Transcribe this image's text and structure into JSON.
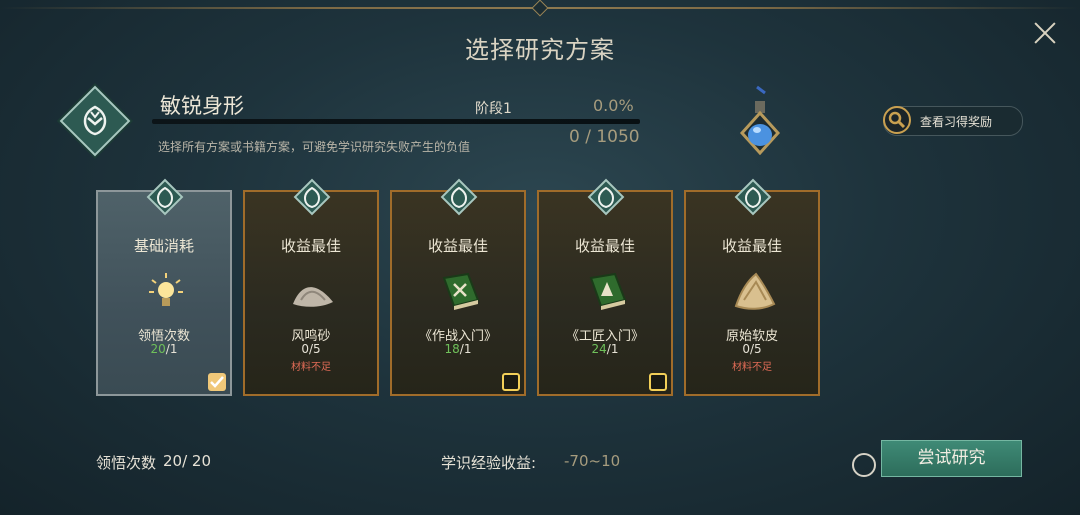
{
  "title": "选择研究方案",
  "skill": {
    "name": "敏锐身形",
    "stage": "阶段1",
    "percent": "0.0%",
    "exp_current": "0",
    "exp_total": "1050",
    "exp_display": "0 / 1050",
    "hint": "选择所有方案或书籍方案，可避免学识研究失败产生的负值"
  },
  "reward_button": {
    "label": "查看习得奖励",
    "icon": "magnifier-icon"
  },
  "cards": [
    {
      "title": "基础消耗",
      "item": "领悟次数",
      "have": "20",
      "need": "/1",
      "have_color": "green",
      "warn": "",
      "checked": true,
      "icon": "lightbulb-icon"
    },
    {
      "title": "收益最佳",
      "item": "风鸣砂",
      "have": "0",
      "need": "/5",
      "have_color": "white",
      "warn": "材料不足",
      "checked": false,
      "icon": "sand-pile-icon"
    },
    {
      "title": "收益最佳",
      "item": "《作战入门》",
      "have": "18",
      "need": "/1",
      "have_color": "green",
      "warn": "",
      "checked": false,
      "icon": "combat-book-icon"
    },
    {
      "title": "收益最佳",
      "item": "《工匠入门》",
      "have": "24",
      "need": "/1",
      "have_color": "green",
      "warn": "",
      "checked": false,
      "icon": "craft-book-icon"
    },
    {
      "title": "收益最佳",
      "item": "原始软皮",
      "have": "0",
      "need": "/5",
      "have_color": "white",
      "warn": "材料不足",
      "checked": false,
      "icon": "leather-hide-icon"
    }
  ],
  "footer": {
    "insight_label": "领悟次数",
    "insight_value": "20/ 20",
    "exp_gain_label": "学识经验收益:",
    "exp_gain_value": "-70~10",
    "try_button": "尝试研究"
  },
  "colors": {
    "green": "#6fc05a",
    "warn": "#e06b56",
    "gold": "#a06c2a",
    "accent": "#2d6d5b"
  }
}
